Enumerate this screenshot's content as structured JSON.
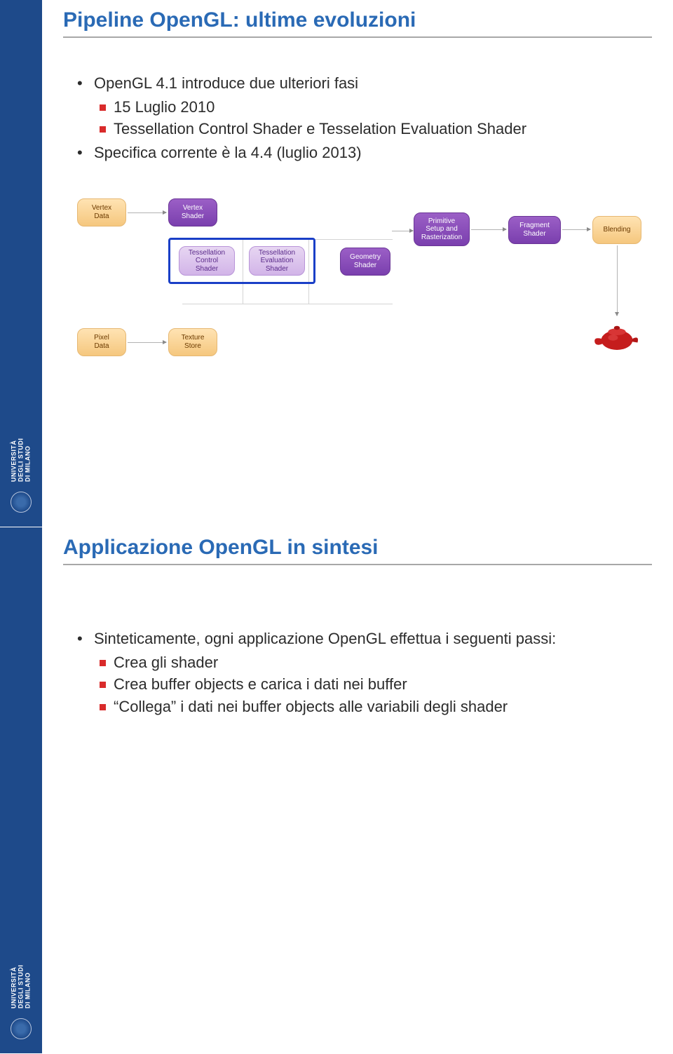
{
  "university": {
    "line1": "UNIVERSITÀ",
    "line2": "DEGLI STUDI",
    "line3": "DI MILANO"
  },
  "slide1": {
    "title": "Pipeline OpenGL: ultime evoluzioni",
    "b1": "OpenGL 4.1 introduce due ulteriori fasi",
    "b1a": "15 Luglio 2010",
    "b1b": "Tessellation Control Shader e Tesselation Evaluation Shader",
    "b2": "Specifica corrente è la 4.4 (luglio 2013)",
    "diagram": {
      "vertex_data": "Vertex\nData",
      "vertex_shader": "Vertex\nShader",
      "tess_control": "Tessellation\nControl\nShader",
      "tess_eval": "Tessellation\nEvaluation\nShader",
      "geom": "Geometry\nShader",
      "prim": "Primitive\nSetup and\nRasterization",
      "frag": "Fragment\nShader",
      "blend": "Blending",
      "pixel_data": "Pixel\nData",
      "tex_store": "Texture\nStore"
    }
  },
  "slide2": {
    "title": "Applicazione OpenGL in sintesi",
    "b1": "Sinteticamente, ogni applicazione OpenGL effettua i seguenti passi:",
    "b1a": "Crea gli shader",
    "b1b": "Crea buffer objects e carica i dati nei buffer",
    "b1c": "“Collega” i dati nei buffer objects alle variabili degli shader"
  }
}
